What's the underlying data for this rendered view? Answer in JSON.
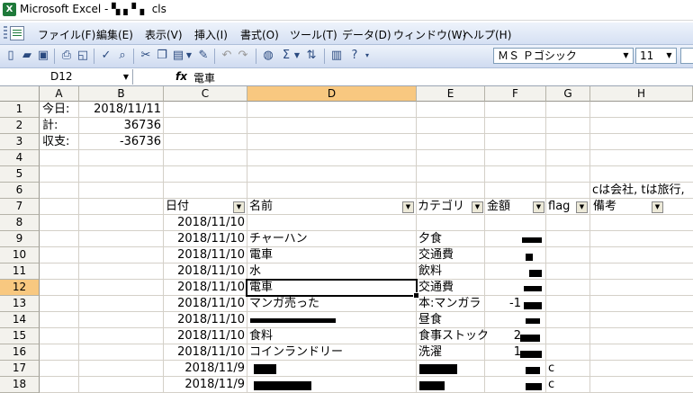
{
  "window": {
    "app_icon": "X",
    "title": "Microsoft Excel - ▚ ▖▘▖ cls"
  },
  "menu": [
    "ファイル(F)",
    "編集(E)",
    "表示(V)",
    "挿入(I)",
    "書式(O)",
    "ツール(T)",
    "データ(D)",
    "ウィンドウ(W)",
    "ヘルプ(H)"
  ],
  "toolbar": {
    "font_name": "ＭＳ Ｐゴシック",
    "font_size": "11"
  },
  "formula": {
    "cell_ref": "D12",
    "fx": "fx",
    "content": "電車"
  },
  "columns": [
    "A",
    "B",
    "C",
    "D",
    "E",
    "F",
    "G",
    "H"
  ],
  "active_col": "D",
  "rows": [
    "1",
    "2",
    "3",
    "4",
    "5",
    "6",
    "7",
    "8",
    "9",
    "10",
    "11",
    "12",
    "13",
    "14",
    "15",
    "16",
    "17",
    "18"
  ],
  "active_row": "12",
  "summary": [
    {
      "label": "今日:",
      "value": "2018/11/11"
    },
    {
      "label": "計:",
      "value": "36736"
    },
    {
      "label": "収支:",
      "value": "-36736"
    }
  ],
  "note": "cは会社, tは旅行,",
  "headers": {
    "date": "日付",
    "name": "名前",
    "category": "カテゴリ",
    "amount": "金額",
    "flag": "flag",
    "memo": "備考"
  },
  "records": [
    {
      "date": "2018/11/10",
      "name": "",
      "category": "",
      "amount": "",
      "flag": ""
    },
    {
      "date": "2018/11/10",
      "name": "チャーハン",
      "category": "夕食",
      "amount": "",
      "flag": ""
    },
    {
      "date": "2018/11/10",
      "name": "電車",
      "category": "交通費",
      "amount": "",
      "flag": ""
    },
    {
      "date": "2018/11/10",
      "name": "水",
      "category": "飲料",
      "amount": "",
      "flag": ""
    },
    {
      "date": "2018/11/10",
      "name": "電車",
      "category": "交通費",
      "amount": "",
      "flag": ""
    },
    {
      "date": "2018/11/10",
      "name": "マンガ売った",
      "category": "本:マンガラ",
      "amount": "-1",
      "flag": ""
    },
    {
      "date": "2018/11/10",
      "name": "",
      "category": "昼食",
      "amount": "",
      "flag": ""
    },
    {
      "date": "2018/11/10",
      "name": "食料",
      "category": "食事ストック",
      "amount": "2",
      "flag": ""
    },
    {
      "date": "2018/11/10",
      "name": "コインランドリー",
      "category": "洗濯",
      "amount": "1",
      "flag": ""
    },
    {
      "date": "2018/11/9",
      "name": "",
      "category": "",
      "amount": "",
      "flag": "c"
    },
    {
      "date": "2018/11/9",
      "name": "",
      "category": "",
      "amount": "",
      "flag": "c"
    }
  ]
}
